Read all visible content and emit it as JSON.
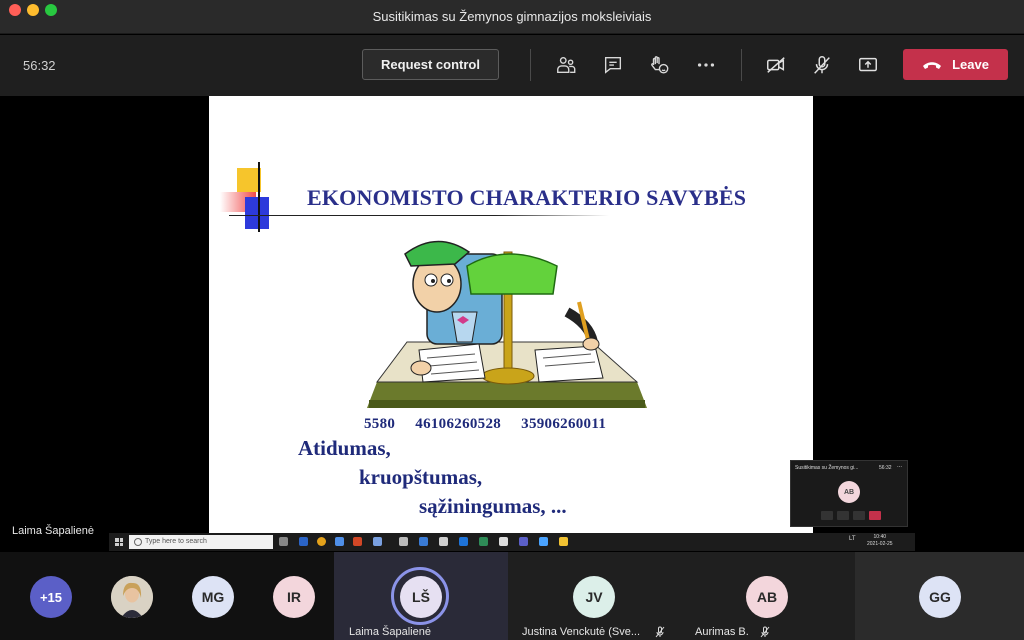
{
  "window": {
    "title": "Susitikimas su Žemynos gimnazijos moksleiviais"
  },
  "toolbar": {
    "timer": "56:32",
    "request_control_label": "Request control",
    "leave_label": "Leave"
  },
  "slide": {
    "title": "EKONOMISTO CHARAKTERIO SAVYBĖS",
    "numbers": [
      "5580",
      "46106260528",
      "35906260011"
    ],
    "traits": [
      "Atidumas,",
      "kruopštumas,",
      "sąžiningumas, ..."
    ]
  },
  "shared_taskbar": {
    "search_placeholder": "Type here to search",
    "time": "10:40",
    "date": "2021-02-25",
    "lang": "LT"
  },
  "mini_window": {
    "title": "Susitikimas su Žemynos gi...",
    "time": "56:32",
    "more": "...",
    "avatar_initials": "AB"
  },
  "presenter": {
    "name": "Laima Šapalienė"
  },
  "participants": [
    {
      "initials": "+15"
    },
    {
      "initials": "",
      "has_photo": true
    },
    {
      "initials": "MG"
    },
    {
      "initials": "IR"
    },
    {
      "initials": "LŠ",
      "name": "Laima Šapalienė",
      "speaking": true
    },
    {
      "initials": "JV",
      "name": "Justina Venckutė (Sve..."
    },
    {
      "initials": "AB",
      "name": "Aurimas B."
    },
    {
      "initials": "GG"
    }
  ],
  "colors": {
    "leave": "#c4314b",
    "slide_text": "#1f2a7a",
    "speaking_ring": "#8b93e8"
  }
}
